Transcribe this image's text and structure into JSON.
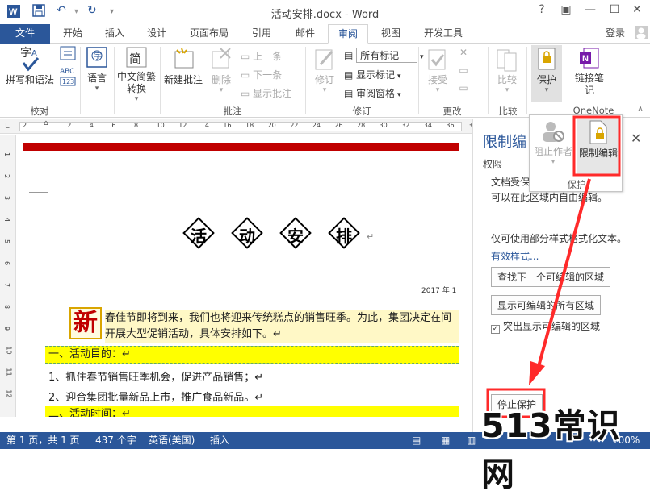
{
  "app": {
    "title": "活动安排.docx - Word",
    "login": "登录"
  },
  "tabs": [
    "文件",
    "开始",
    "插入",
    "设计",
    "页面布局",
    "引用",
    "邮件",
    "审阅",
    "视图",
    "开发工具"
  ],
  "ribbon": {
    "proofing": {
      "label": "拼写和语法",
      "group": "校对"
    },
    "language": {
      "label": "语言"
    },
    "chinese": {
      "label": "中文简繁转换"
    },
    "comments": {
      "new": "新建批注",
      "delete": "删除",
      "prev": "上一条",
      "next": "下一条",
      "show": "显示批注",
      "group": "批注"
    },
    "tracking": {
      "track": "修订",
      "markup_select": "所有标记",
      "show_markup": "显示标记",
      "review_pane": "审阅窗格",
      "group": "修订"
    },
    "changes": {
      "accept": "接受",
      "group": "更改"
    },
    "compare": {
      "label": "比较",
      "group": "比较"
    },
    "protect": {
      "label": "保护"
    },
    "onenote": {
      "label": "链接笔记",
      "group": "OneNote"
    }
  },
  "dropdown": {
    "block": "阻止作者",
    "restrict": "限制编辑",
    "group": "保护"
  },
  "ruler": {
    "marks": [
      "2",
      "",
      "2",
      "4",
      "6",
      "8",
      "10",
      "12",
      "14",
      "16",
      "18",
      "20",
      "22",
      "24",
      "26",
      "28",
      "30",
      "32",
      "34",
      "36",
      "38"
    ]
  },
  "vruler": [
    "1",
    "2",
    "3",
    "4",
    "5",
    "6",
    "7",
    "8",
    "9",
    "10",
    "11",
    "12"
  ],
  "doc": {
    "heading": [
      "活",
      "动",
      "安",
      "排"
    ],
    "date": "2017 年 1",
    "xin": "新",
    "para": "春佳节即将到来，我们也将迎来传统糕点的销售旺季。为此，集团决定在间开展大型促销活动，具体安排如下。↵",
    "h1": "一、活动目的：↵",
    "l1": "1、抓住春节销售旺季机会，促进产品销售；↵",
    "l2": "2、迎合集团批量新品上市，推广食品新品。↵",
    "h2": "二、活动时间：↵"
  },
  "pane": {
    "title": "限制编",
    "sub": "权限",
    "t1": "文档受保",
    "t2": "可以在此区域内自由编辑。",
    "t3": "仅可使用部分样式格式化文本。",
    "link": "有效样式...",
    "btn1": "查找下一个可编辑的区域",
    "btn2": "显示可编辑的所有区域",
    "chk": "突出显示可编辑的区域",
    "stop": "停止保护"
  },
  "status": {
    "page": "第 1 页，共 1 页",
    "words": "437 个字",
    "lang": "英语(美国)",
    "insert": "插入",
    "zoom": "100%"
  },
  "watermark": "513常识网"
}
